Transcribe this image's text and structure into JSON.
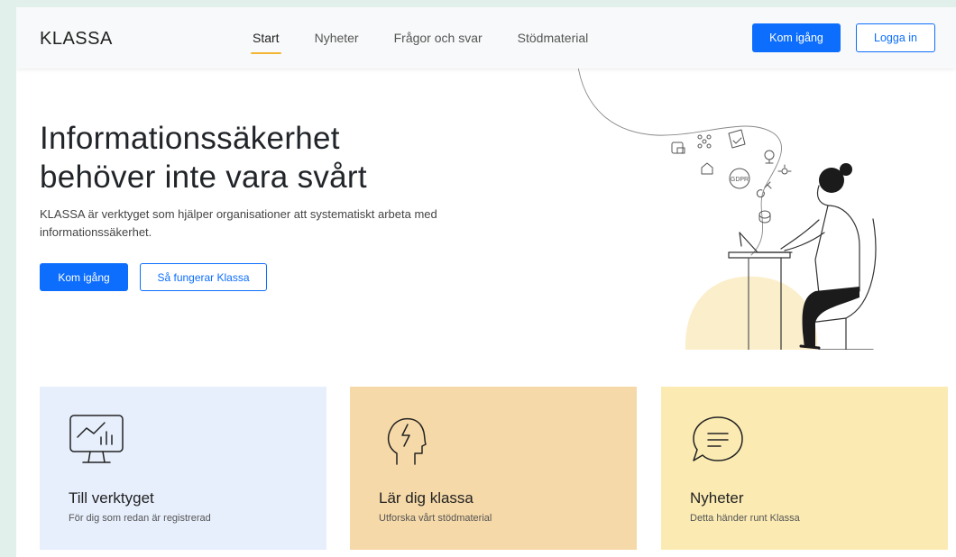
{
  "header": {
    "logo": "KLASSA",
    "nav": [
      {
        "label": "Start",
        "active": true
      },
      {
        "label": "Nyheter",
        "active": false
      },
      {
        "label": "Frågor och svar",
        "active": false
      },
      {
        "label": "Stödmaterial",
        "active": false
      }
    ],
    "primary_button": "Kom igång",
    "login_button": "Logga in"
  },
  "hero": {
    "title_line1": "Informationssäkerhet",
    "title_line2": "behöver inte vara svårt",
    "lead": "KLASSA är verktyget som hjälper organisationer att systematiskt arbeta med informationssäkerhet.",
    "primary_button": "Kom igång",
    "secondary_button": "Så fungerar Klassa",
    "illustration_badge": "GDPR"
  },
  "cards": [
    {
      "title": "Till verktyget",
      "subtitle": "För dig som redan är registrerad",
      "icon": "monitor-chart-icon",
      "color": "#e7effd"
    },
    {
      "title": "Lär dig klassa",
      "subtitle": "Utforska vårt stödmaterial",
      "icon": "head-lightning-icon",
      "color": "#f6d9a8"
    },
    {
      "title": "Nyheter",
      "subtitle": "Detta händer runt Klassa",
      "icon": "speech-bubble-icon",
      "color": "#fbebb3"
    }
  ],
  "colors": {
    "accent": "#0d6efd",
    "nav_underline": "#f2b632"
  }
}
